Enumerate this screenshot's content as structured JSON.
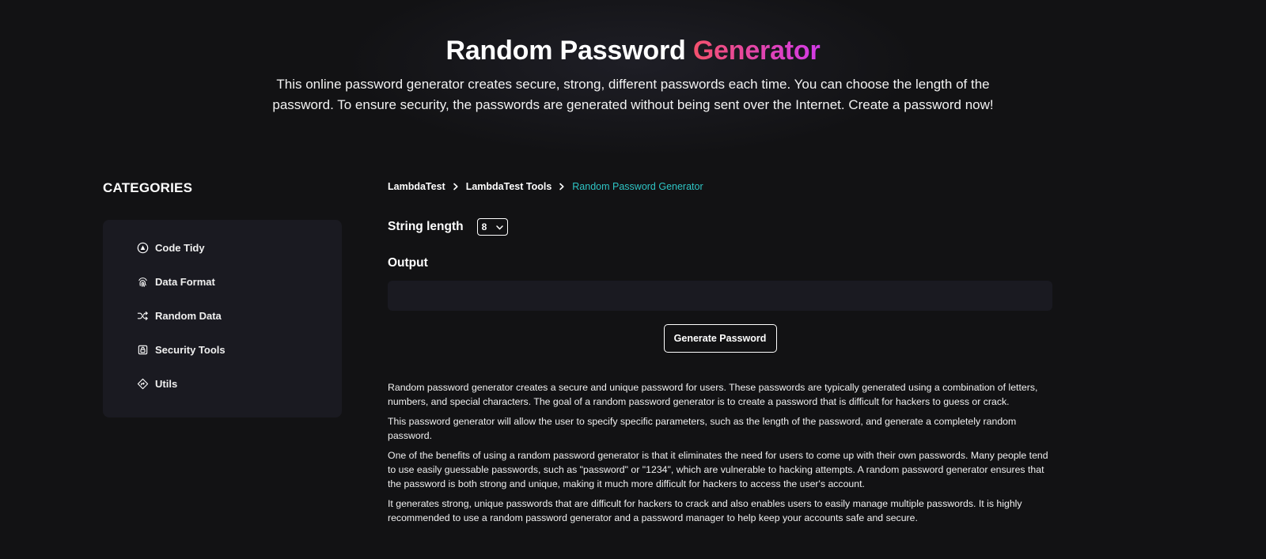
{
  "hero": {
    "title_main": "Random Password",
    "title_accent": "Generator",
    "description": "This online password generator creates secure, strong, different passwords each time. You can choose the length of the password. To ensure security, the passwords are generated without being sent over the Internet. Create a password now!"
  },
  "sidebar": {
    "title": "CATEGORIES",
    "items": [
      {
        "label": "Code Tidy",
        "icon": "code-tidy-icon"
      },
      {
        "label": "Data Format",
        "icon": "fingerprint-icon"
      },
      {
        "label": "Random Data",
        "icon": "shuffle-icon"
      },
      {
        "label": "Security Tools",
        "icon": "lock-icon"
      },
      {
        "label": "Utils",
        "icon": "utils-icon"
      }
    ]
  },
  "breadcrumb": {
    "items": [
      "LambdaTest",
      "LambdaTest Tools"
    ],
    "current": "Random Password Generator"
  },
  "form": {
    "string_length_label": "String length",
    "string_length_value": "8",
    "output_label": "Output",
    "output_value": "",
    "generate_label": "Generate Password"
  },
  "content": {
    "paragraphs": [
      "Random password generator creates a secure and unique password for users. These passwords are typically generated using a combination of letters, numbers, and special characters. The goal of a random password generator is to create a password that is difficult for hackers to guess or crack.",
      "This password generator will allow the user to specify specific parameters, such as the length of the password, and generate a completely random password.",
      "One of the benefits of using a random password generator is that it eliminates the need for users to come up with their own passwords. Many people tend to use easily guessable passwords, such as \"password\" or \"1234\", which are vulnerable to hacking attempts. A random password generator ensures that the password is both strong and unique, making it much more difficult for hackers to access the user's account.",
      "It generates strong, unique passwords that are difficult for hackers to crack and also enables users to easily manage multiple passwords. It is highly recommended to use a random password generator and a password manager to help keep your accounts safe and secure."
    ]
  },
  "colors": {
    "background": "#121214",
    "panel": "#1a1a21",
    "accent_start": "#f4516c",
    "accent_end": "#d23ae8",
    "breadcrumb_current": "#2ec5c5"
  }
}
